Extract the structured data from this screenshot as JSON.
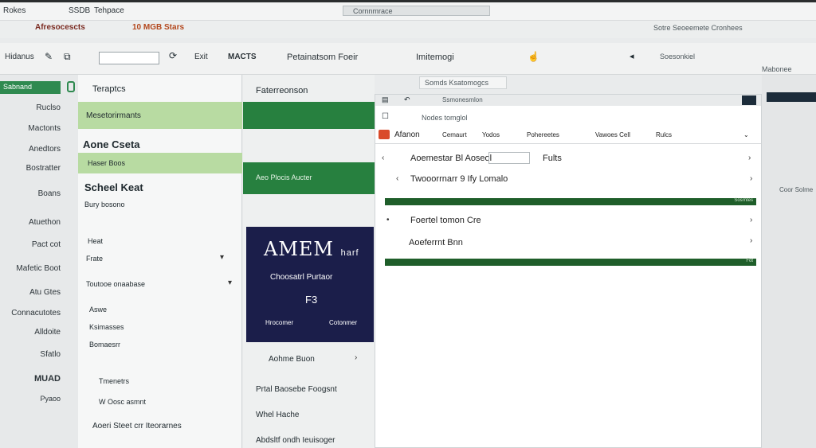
{
  "browser": {
    "tab1": "Rokes",
    "tab2": "SSDB",
    "tab3": "Tehpace",
    "app_title": "Afresocescts",
    "app_sub": "10 MGB Stars",
    "addr_hint": "Cornnmrace",
    "right_hint": "Sotre Seoeemete Cronhees"
  },
  "toolbar": {
    "item1": "Hidanus",
    "item2": "Exit",
    "item3": "MACTS",
    "title_center": "Petainatsom Foeir",
    "title_right": "Imitemogi",
    "far_right": "Soesonkiel",
    "far_far_right": "Mabonee"
  },
  "leftnav": {
    "active": "Sabnand",
    "items": [
      "Ruclso",
      "Mactonts",
      "Anedtors",
      "Bostratter",
      "Boans",
      "Atuethon",
      "Pact cot",
      "Mafetic Boot",
      "Atu Gtes",
      "Connacutotes",
      "Alldoite",
      "Sfatlo",
      "MUAD",
      "Pyaoo"
    ]
  },
  "panel2": {
    "heading": "Teraptcs",
    "active_label": "Mesetorirmants",
    "section_title": "Aone Cseta",
    "section_sub": "Haser Boos",
    "school_title": "Scheel Keat",
    "school_sub": "Bury bosono",
    "label_heat": "Heat",
    "items": [
      "Frate",
      "Toutooe onaabase",
      "Aswe",
      "Ksimasses",
      "Bomaesrr",
      "Tmenetrs",
      "W Oosc asmnt",
      "Aoeri Steet crr Iteorarnes"
    ]
  },
  "panel3": {
    "heading": "Faterreonson",
    "banner": "Aeo Plocis Aucter",
    "promo": {
      "brand": "AMEM",
      "brand_suffix": "harf",
      "line1": "Choosatrl Purtaor",
      "logo": "F3",
      "footer_left": "Hrocomer",
      "footer_right": "Cotonmer"
    },
    "items": [
      "Aohme Buon",
      "Prtal Baosebe Foogsnt",
      "Whel Hache",
      "Abdsltf ondh Ieuisoger"
    ]
  },
  "content": {
    "top_hint": "Somds Ksatomogcs",
    "search_label": "Ssmonesmlon",
    "header_tab": "Nodes tomglol",
    "cols": [
      "Afanon",
      "Cemaurt",
      "Yodos",
      "Pohereetes",
      "Vawoes Cell",
      "Rulcs"
    ],
    "rows": [
      {
        "label": "Aoemestar Bl Aoseol",
        "extra": "Fults"
      },
      {
        "label": "Twooorrnarr 9 Ify Lomalo",
        "extra": ""
      },
      {
        "label": "Foertel tomon Cre",
        "extra": ""
      },
      {
        "label": "Aoeferrnt Bnn",
        "extra": ""
      }
    ],
    "bar1_label": "Sosrntes",
    "bar2_label": "Fot"
  },
  "rightside": {
    "hint": "Coor Solme"
  },
  "colors": {
    "accent_green": "#2f8a50",
    "light_green": "#b8dba2",
    "dark_green": "#27803f",
    "promo_navy": "#1b1e4a",
    "progress_green": "#1f5e2a"
  }
}
